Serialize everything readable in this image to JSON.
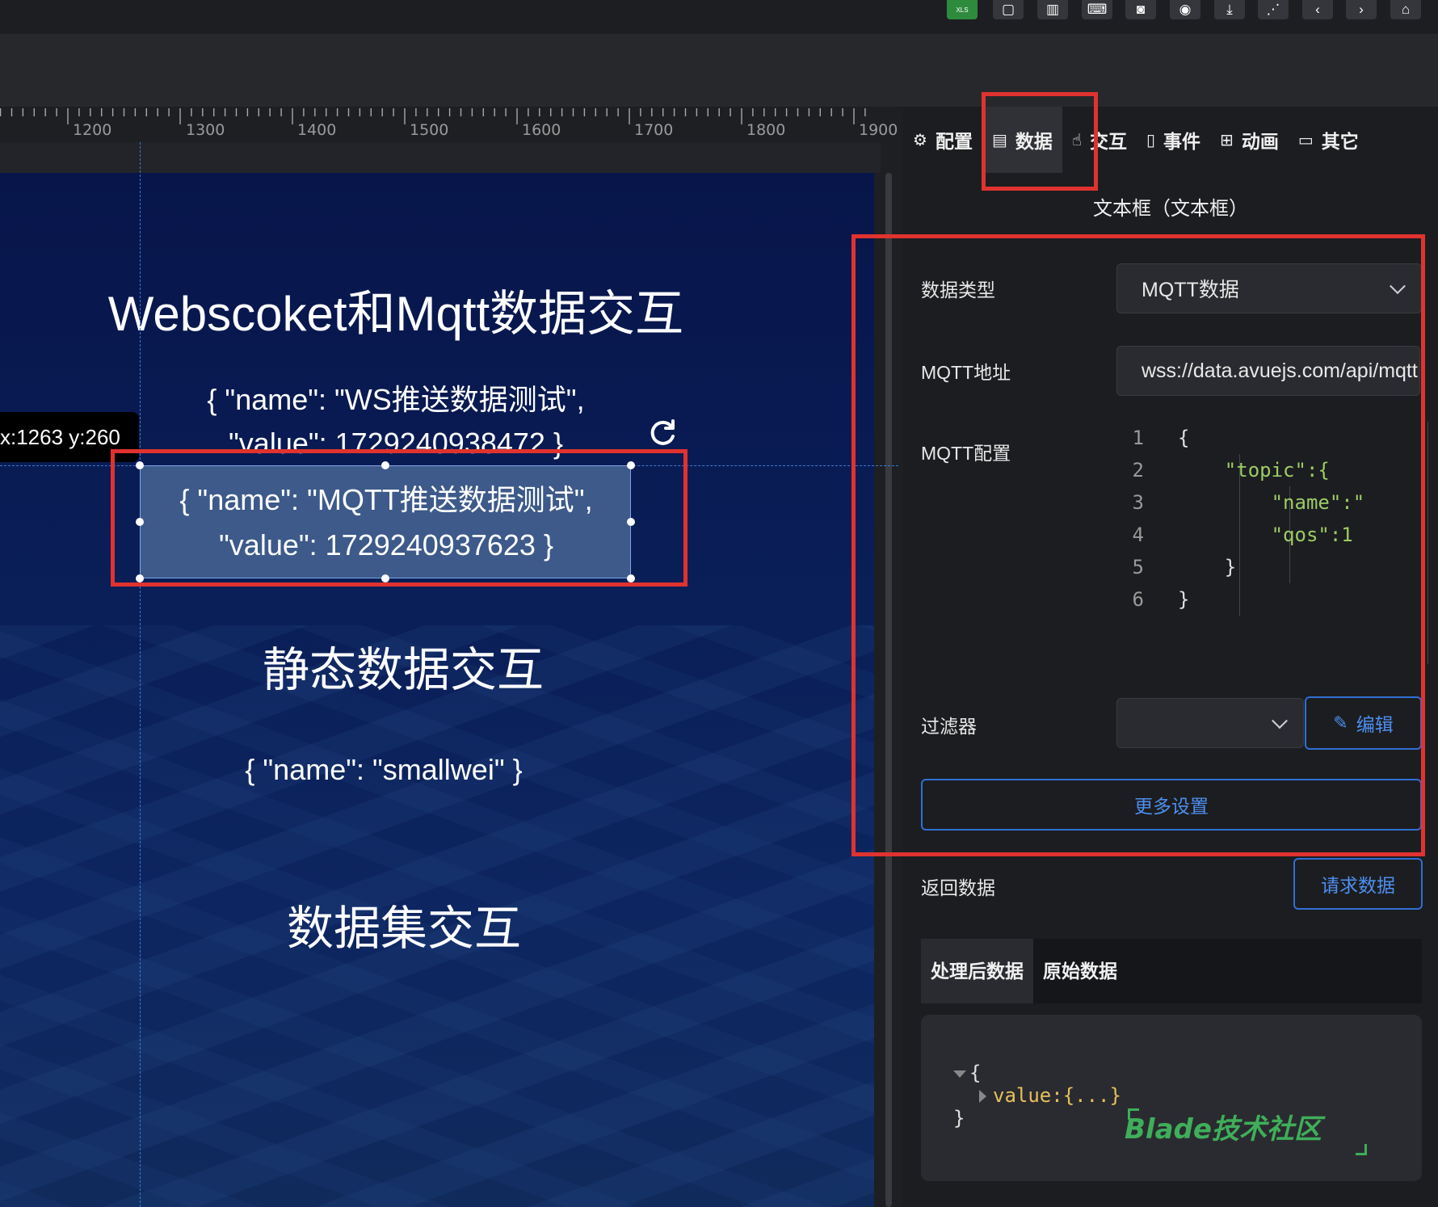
{
  "toolbar": {
    "icons": [
      "xls-icon",
      "square-icon",
      "trash-icon",
      "keyboard-icon",
      "camera-icon",
      "eye-icon",
      "download-icon",
      "share-icon",
      "back-icon",
      "forward-icon",
      "home-icon"
    ],
    "xls_label": "XLS"
  },
  "ruler": {
    "labels": [
      "1200",
      "1300",
      "1400",
      "1500",
      "1600",
      "1700",
      "1800",
      "1900"
    ]
  },
  "canvas": {
    "title1": "Webscoket和Mqtt数据交互",
    "ws_line1": "{ \"name\": \"WS推送数据测试\",",
    "ws_line2": "\"value\": 1729240938472 }",
    "coord": "x:1263 y:260",
    "mqtt_line1": "{ \"name\": \"MQTT推送数据测试\",",
    "mqtt_line2": "\"value\": 1729240937623 }",
    "title2": "静态数据交互",
    "static_text": "{ \"name\": \"smallwei\" }",
    "title3": "数据集交互"
  },
  "panel": {
    "tabs": [
      {
        "icon": "gear-icon",
        "label": "配置"
      },
      {
        "icon": "data-icon",
        "label": "数据"
      },
      {
        "icon": "hand-icon",
        "label": "交互"
      },
      {
        "icon": "mouse-icon",
        "label": "事件"
      },
      {
        "icon": "grid-icon",
        "label": "动画"
      },
      {
        "icon": "folder-icon",
        "label": "其它"
      }
    ],
    "active_tab": "数据",
    "component_title": "文本框（文本框）",
    "data_type_label": "数据类型",
    "data_type_value": "MQTT数据",
    "mqtt_url_label": "MQTT地址",
    "mqtt_url_value": "wss://data.avuejs.com/api/mqtt",
    "mqtt_config_label": "MQTT配置",
    "code_lines": [
      {
        "n": "1",
        "text": "{"
      },
      {
        "n": "2",
        "text": "\"topic\":{"
      },
      {
        "n": "3",
        "text": "\"name\":\""
      },
      {
        "n": "4",
        "text": "\"qos\":1"
      },
      {
        "n": "5",
        "text": "}"
      },
      {
        "n": "6",
        "text": "}"
      }
    ],
    "filter_label": "过滤器",
    "filter_value": "",
    "edit_button": "编辑",
    "more_settings": "更多设置",
    "return_data_label": "返回数据",
    "request_button": "请求数据",
    "result_tabs": [
      "处理后数据",
      "原始数据"
    ],
    "result_open": "{",
    "result_key": "value:",
    "result_value": "{...}",
    "result_close": "}"
  },
  "watermark": "Blade技术社区",
  "colors": {
    "highlight_red": "#e0332f",
    "accent_blue": "#2f6fd6",
    "canvas_bg": "#07154a",
    "code_green": "#9ccc65"
  }
}
